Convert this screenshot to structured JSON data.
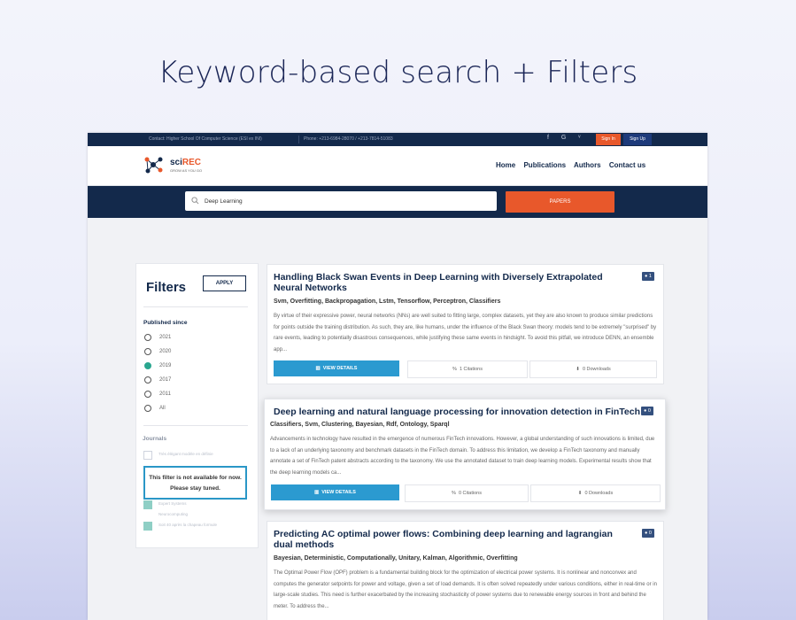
{
  "slide_title": "Keyword-based search + Filters",
  "topbar": {
    "contact": "Contact: Higher School Of Computer Science (ESI ex INI)",
    "phone": "Phone: +213-6984-28070 / +213-7814-51083",
    "social_icons": [
      "facebook-icon",
      "google-icon",
      "twitter-icon"
    ],
    "social_glyphs": "f G ᵛ",
    "signin": "Sign In",
    "signup": "Sign Up"
  },
  "header": {
    "logo_prefix": "sci",
    "logo_suffix": "REC",
    "tagline": "GROW AS YOU GO",
    "nav": [
      "Home",
      "Publications",
      "Authors",
      "Contact us"
    ]
  },
  "search": {
    "value": "Deep Learning",
    "button": "PAPERS"
  },
  "filters": {
    "title": "Filters",
    "apply": "APPLY",
    "published_since_label": "Published since",
    "years": [
      "2021",
      "2020",
      "2019",
      "2017",
      "2011",
      "All"
    ],
    "selected_year": "2019",
    "journals_label": "Journals",
    "journals": [
      "Très élégant modèle en définie",
      "Journal of Applied Learning",
      "Expert Systems",
      "Neurocomputing",
      "Scientific",
      "Soit 40 après la chapeau formule"
    ],
    "notice": "This filter is not available for now. Please stay tuned."
  },
  "papers": [
    {
      "title": "Handling Black Swan Events in Deep Learning with Diversely Extrapolated Neural Networks",
      "views": "1",
      "keywords": "Svm, Overfitting, Backpropagation, Lstm, Tensorflow, Perceptron, Classifiers",
      "abstract": "By virtue of their expressive power, neural networks (NNs) are well suited to fitting large, complex datasets, yet they are also known to produce similar predictions for points outside the training distribution. As such, they are, like humans, under the influence of the Black Swan theory: models tend to be extremely \"surprised\" by rare events, leading to potentially disastrous consequences, while justifying these same events in hindsight. To avoid this pitfall, we introduce DENN, an ensemble app...",
      "view_details": "VIEW DETAILS",
      "citations": "1 Citations",
      "downloads": "0 Downloads"
    },
    {
      "title": "Deep learning and natural language processing for innovation detection in FinTech",
      "views": "0",
      "keywords": "Classifiers, Svm, Clustering, Bayesian, Rdf, Ontology, Sparql",
      "abstract": "Advancements in technology have resulted in the emergence of numerous FinTech innovations. However, a global understanding of such innovations is limited, due to a lack of an underlying taxonomy and benchmark datasets in the FinTech domain. To address this limitation, we develop a FinTech taxonomy and manually annotate a set of FinTech patent abstracts according to the taxonomy. We use the annotated dataset to train deep learning models. Experimental results show that the deep learning models ca...",
      "view_details": "VIEW DETAILS",
      "citations": "0 Citations",
      "downloads": "0 Downloads"
    },
    {
      "title": "Predicting AC optimal power flows: Combining deep learning and lagrangian dual methods",
      "views": "0",
      "keywords": "Bayesian, Deterministic, Computationally, Unitary, Kalman, Algorithmic, Overfitting",
      "abstract": "The Optimal Power Flow (OPF) problem is a fundamental building block for the optimization of electrical power systems. It is nonlinear and nonconvex and computes the generator setpoints for power and voltage, given a set of load demands. It is often solved repeatedly under various conditions, either in real-time or in large-scale studies. This need is further exacerbated by the increasing stochasticity of power systems due to renewable energy sources in front and behind the meter. To address the..."
    }
  ],
  "colors": {
    "navy": "#13294b",
    "accent_orange": "#e8582b",
    "view_button_blue": "#2b9ad0",
    "selected_radio": "#2aa68f"
  }
}
